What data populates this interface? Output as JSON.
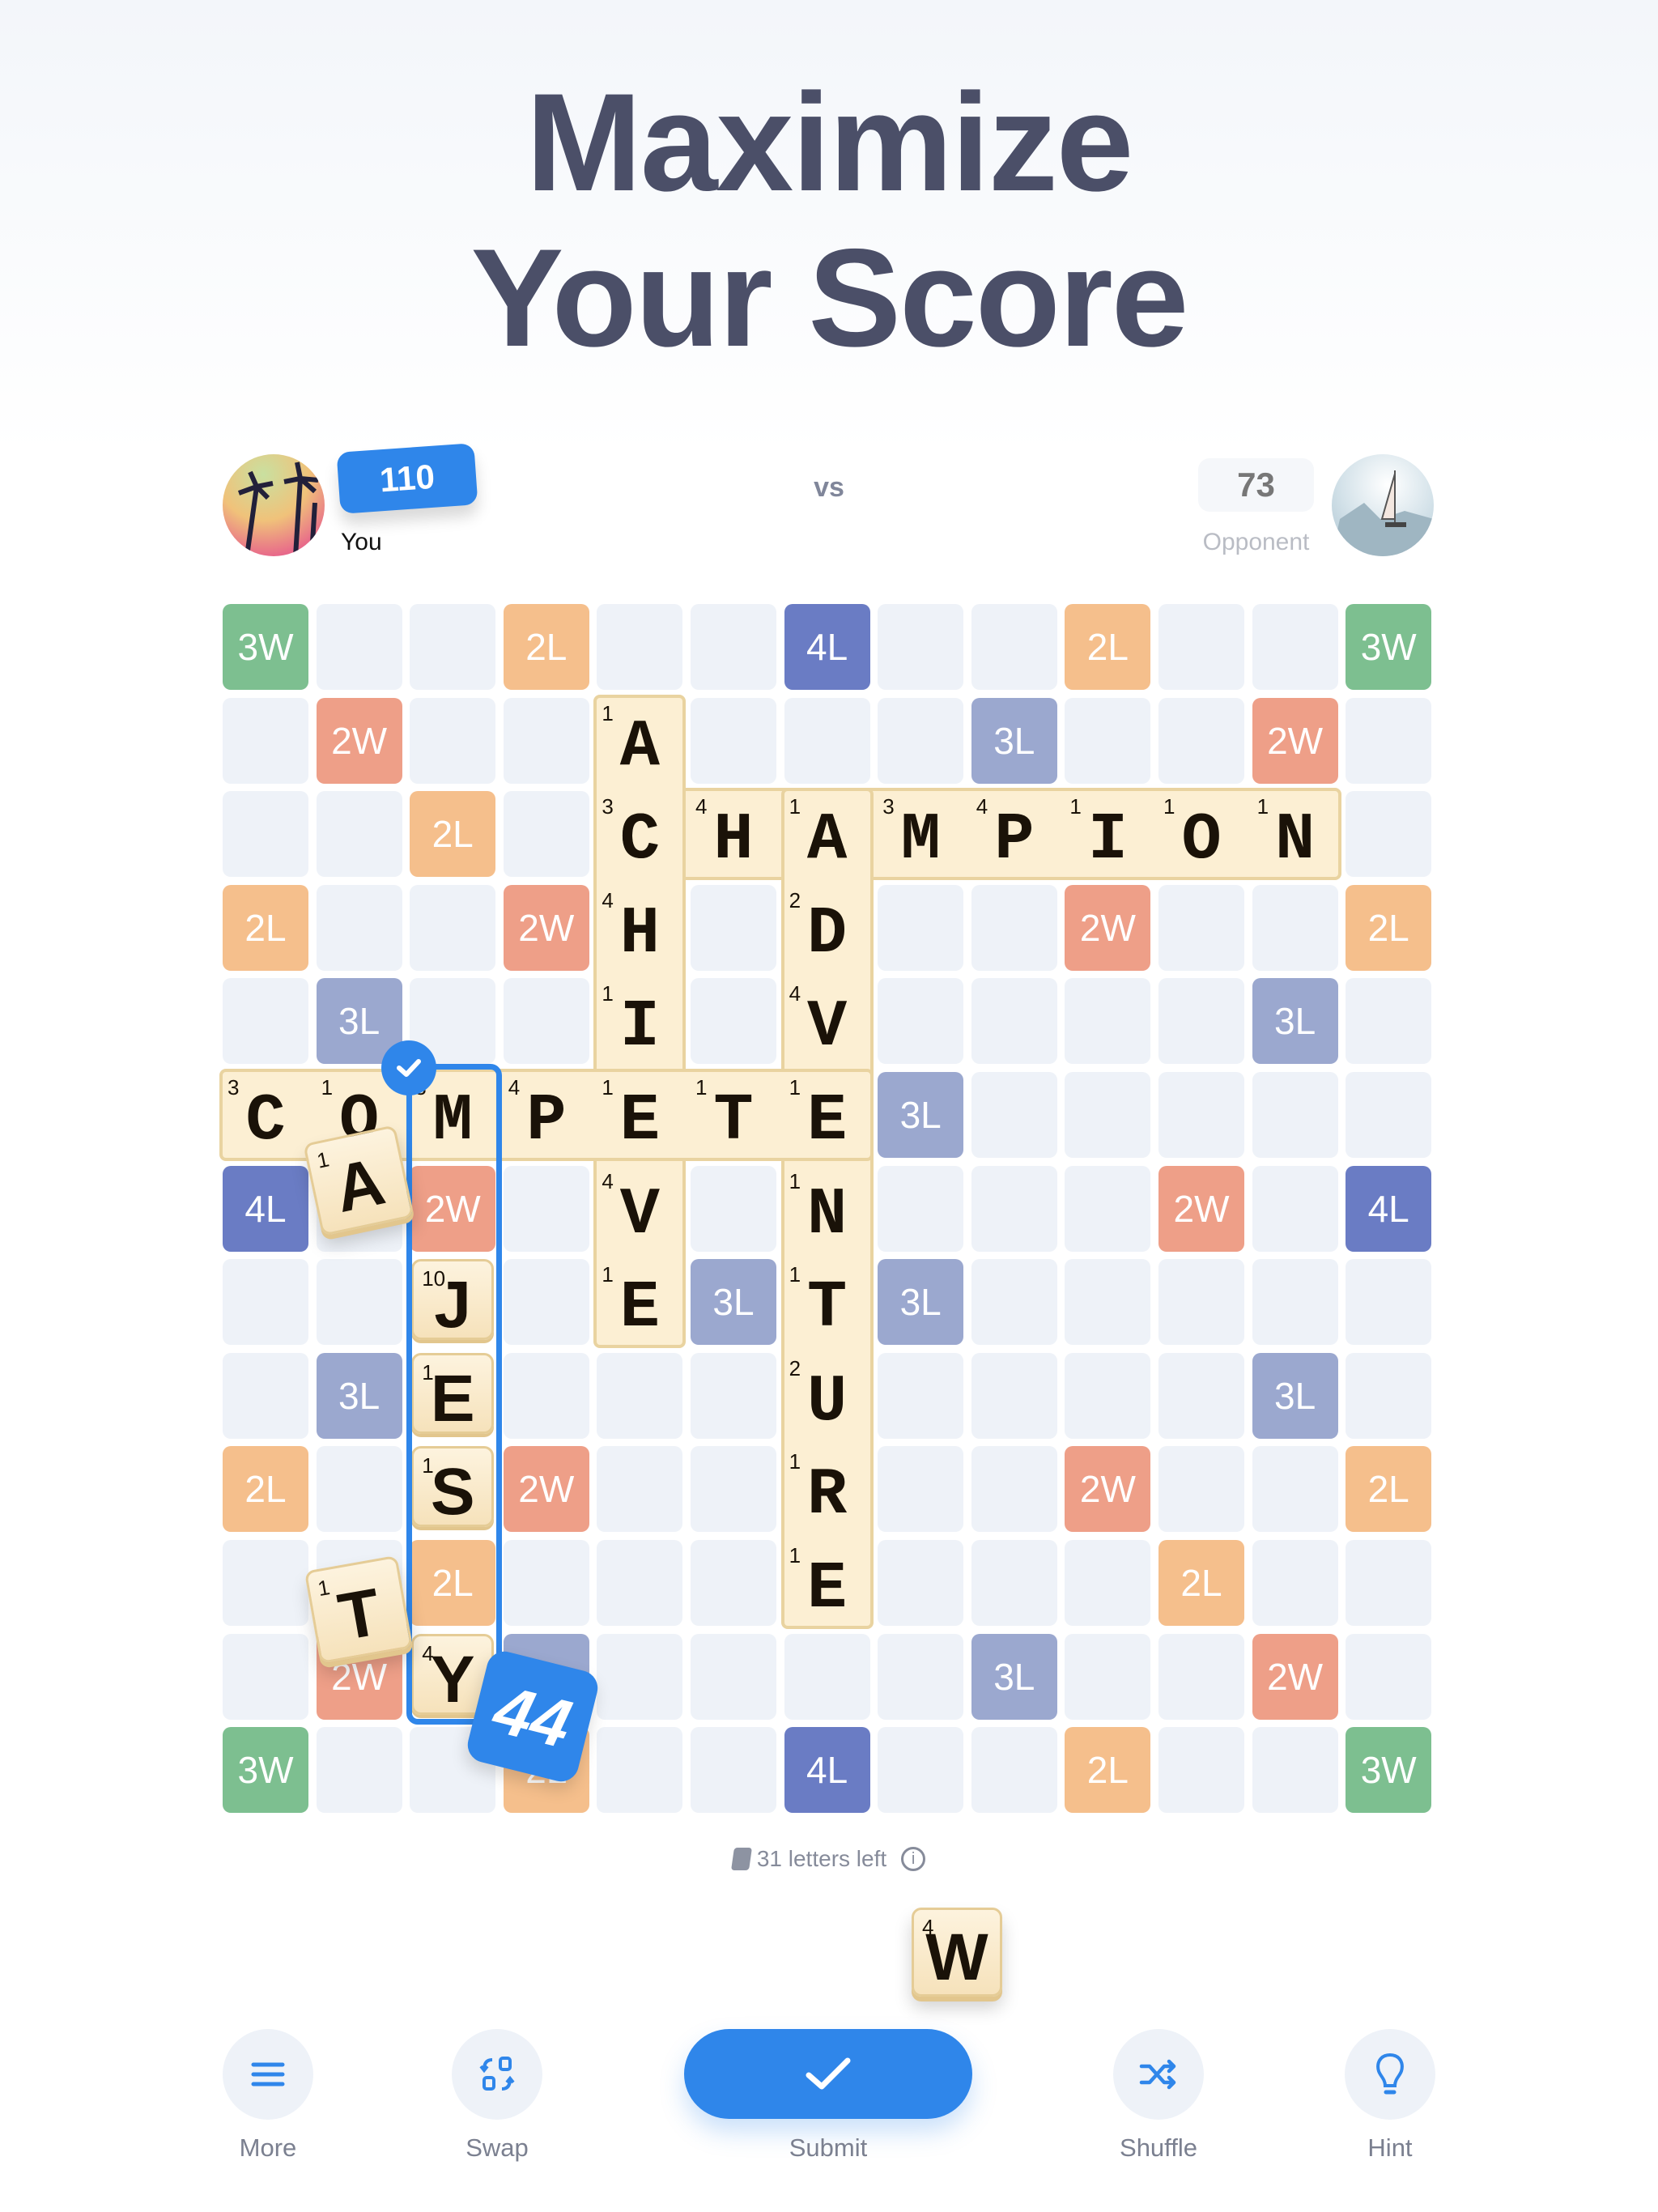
{
  "title": {
    "line1": "Maximize",
    "line2": "Your Score"
  },
  "players": {
    "you": {
      "name": "You",
      "score": "110"
    },
    "vs": "vs",
    "opponent": {
      "name": "Opponent",
      "score": "73"
    }
  },
  "colors": {
    "accent": "#2f86ea",
    "3W": "#7dbf90",
    "2W": "#ee9f88",
    "2L": "#f5bf8c",
    "3L": "#9ba8cf",
    "4L": "#6a7cc4",
    "empty": "#eef2f8",
    "tile": "#fcefd3"
  },
  "letter_scores": {
    "A": 1,
    "C": 3,
    "D": 2,
    "E": 1,
    "H": 4,
    "I": 1,
    "J": 10,
    "M": 3,
    "N": 1,
    "O": 1,
    "P": 4,
    "R": 1,
    "S": 1,
    "T": 1,
    "U": 2,
    "V": 4,
    "W": 4,
    "Y": 4
  },
  "board": {
    "size": 13,
    "premiums": [
      {
        "r": 0,
        "c": 0,
        "t": "3W"
      },
      {
        "r": 0,
        "c": 3,
        "t": "2L"
      },
      {
        "r": 0,
        "c": 6,
        "t": "4L"
      },
      {
        "r": 0,
        "c": 9,
        "t": "2L"
      },
      {
        "r": 0,
        "c": 12,
        "t": "3W"
      },
      {
        "r": 1,
        "c": 1,
        "t": "2W"
      },
      {
        "r": 1,
        "c": 8,
        "t": "3L"
      },
      {
        "r": 1,
        "c": 11,
        "t": "2W"
      },
      {
        "r": 2,
        "c": 2,
        "t": "2L"
      },
      {
        "r": 3,
        "c": 0,
        "t": "2L"
      },
      {
        "r": 3,
        "c": 3,
        "t": "2W"
      },
      {
        "r": 3,
        "c": 9,
        "t": "2W"
      },
      {
        "r": 3,
        "c": 12,
        "t": "2L"
      },
      {
        "r": 4,
        "c": 1,
        "t": "3L"
      },
      {
        "r": 4,
        "c": 11,
        "t": "3L"
      },
      {
        "r": 5,
        "c": 7,
        "t": "3L"
      },
      {
        "r": 6,
        "c": 0,
        "t": "4L"
      },
      {
        "r": 6,
        "c": 2,
        "t": "2W"
      },
      {
        "r": 6,
        "c": 10,
        "t": "2W"
      },
      {
        "r": 6,
        "c": 12,
        "t": "4L"
      },
      {
        "r": 7,
        "c": 5,
        "t": "3L"
      },
      {
        "r": 7,
        "c": 7,
        "t": "3L"
      },
      {
        "r": 8,
        "c": 1,
        "t": "3L"
      },
      {
        "r": 8,
        "c": 11,
        "t": "3L"
      },
      {
        "r": 9,
        "c": 0,
        "t": "2L"
      },
      {
        "r": 9,
        "c": 3,
        "t": "2W"
      },
      {
        "r": 9,
        "c": 9,
        "t": "2W"
      },
      {
        "r": 9,
        "c": 12,
        "t": "2L"
      },
      {
        "r": 10,
        "c": 2,
        "t": "2L"
      },
      {
        "r": 10,
        "c": 10,
        "t": "2L"
      },
      {
        "r": 11,
        "c": 1,
        "t": "2W"
      },
      {
        "r": 11,
        "c": 3,
        "t": "3L"
      },
      {
        "r": 11,
        "c": 8,
        "t": "3L"
      },
      {
        "r": 11,
        "c": 11,
        "t": "2W"
      },
      {
        "r": 12,
        "c": 0,
        "t": "3W"
      },
      {
        "r": 12,
        "c": 3,
        "t": "2L"
      },
      {
        "r": 12,
        "c": 6,
        "t": "4L"
      },
      {
        "r": 12,
        "c": 9,
        "t": "2L"
      },
      {
        "r": 12,
        "c": 12,
        "t": "3W"
      }
    ],
    "words": [
      {
        "text": "CHAMPION",
        "r": 2,
        "c": 4,
        "dir": "across"
      },
      {
        "text": "ACHIEVE",
        "r": 1,
        "c": 4,
        "dir": "down"
      },
      {
        "text": "ADVENTURE",
        "r": 2,
        "c": 6,
        "dir": "down"
      },
      {
        "text": "COMPETE",
        "r": 5,
        "c": 0,
        "dir": "across"
      }
    ],
    "placed": [
      {
        "letter": "J",
        "r": 7,
        "c": 2
      },
      {
        "letter": "E",
        "r": 8,
        "c": 2
      },
      {
        "letter": "S",
        "r": 9,
        "c": 2
      },
      {
        "letter": "Y",
        "r": 11,
        "c": 2
      }
    ],
    "move_score": "44"
  },
  "dragging": [
    {
      "letter": "A",
      "score": "1"
    },
    {
      "letter": "T",
      "score": "1"
    }
  ],
  "rack": {
    "letters_left": "31 letters left",
    "tiles": [
      {
        "letter": "W",
        "score": "4"
      }
    ]
  },
  "toolbar": {
    "more": "More",
    "swap": "Swap",
    "submit": "Submit",
    "shuffle": "Shuffle",
    "hint": "Hint"
  }
}
